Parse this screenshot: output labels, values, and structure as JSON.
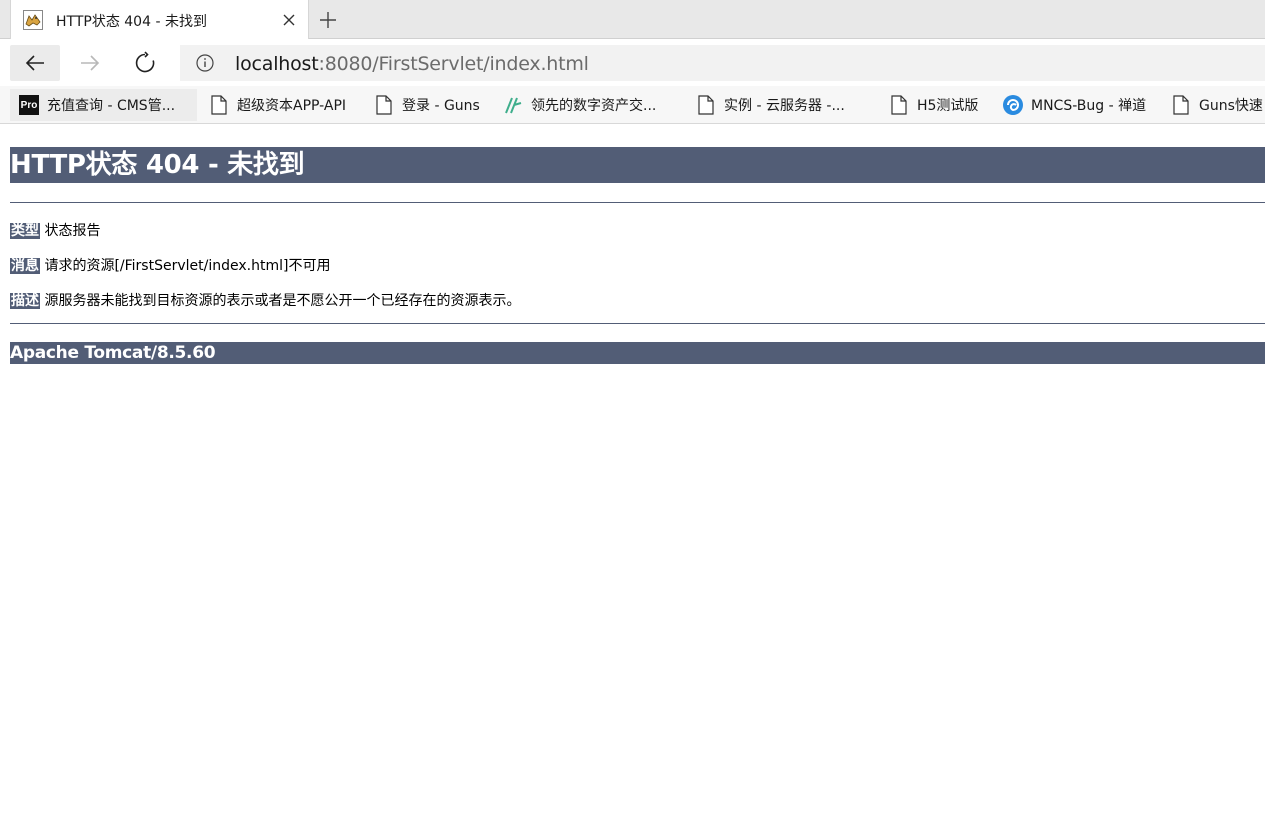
{
  "browser": {
    "tab": {
      "title": "HTTP状态 404 - 未找到",
      "favicon": "tomcat-icon"
    },
    "address": {
      "host": "localhost",
      "rest": ":8080/FirstServlet/index.html"
    },
    "bookmarks": [
      {
        "label": "充值查询 - CMS管...",
        "icon": "pro-icon",
        "icon_text": "Pro"
      },
      {
        "label": "超级资本APP-API",
        "icon": "page-icon"
      },
      {
        "label": "登录 - Guns",
        "icon": "page-icon"
      },
      {
        "label": "领先的数字资产交...",
        "icon": "leaf-icon"
      },
      {
        "label": "实例 - 云服务器 -...",
        "icon": "page-icon"
      },
      {
        "label": "H5测试版",
        "icon": "page-icon"
      },
      {
        "label": "MNCS-Bug - 禅道",
        "icon": "swirl-icon"
      },
      {
        "label": "Guns快速",
        "icon": "page-icon"
      }
    ]
  },
  "page": {
    "heading": "HTTP状态 404 - 未找到",
    "type_label": "类型",
    "type_value": "状态报告",
    "message_label": "消息",
    "message_value": "请求的资源[/FirstServlet/index.html]不可用",
    "description_label": "描述",
    "description_value": "源服务器未能找到目标资源的表示或者是不愿公开一个已经存在的资源表示。",
    "footer": "Apache Tomcat/8.5.60"
  },
  "colors": {
    "tomcat_banner": "#525d76",
    "tab_bg": "#ffffff",
    "tabstrip_bg": "#e8e8e8"
  }
}
